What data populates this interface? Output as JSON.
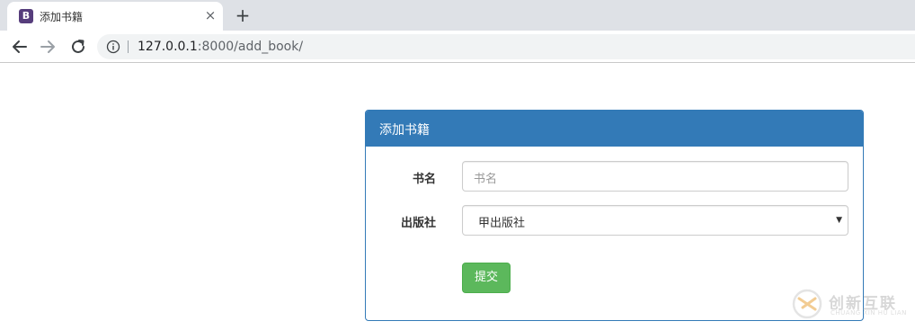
{
  "browser": {
    "tab": {
      "favicon_letter": "B",
      "title": "添加书籍",
      "close_glyph": "×"
    },
    "new_tab_glyph": "+",
    "url_host": "127.0.0.1",
    "url_rest": ":8000/add_book/",
    "icons": [
      "back-arrow-icon",
      "forward-arrow-icon",
      "reload-icon",
      "info-icon"
    ]
  },
  "panel": {
    "title": "添加书籍",
    "form": {
      "name_label": "书名",
      "name_placeholder": "书名",
      "publisher_label": "出版社",
      "publisher_selected": "甲出版社",
      "submit_label": "提交"
    }
  },
  "watermark": {
    "text": "创新互联",
    "sub": "CHUANG XIN HU LIAN"
  },
  "colors": {
    "panel_primary": "#337ab7",
    "submit_green": "#5cb85c",
    "bootstrap_purple": "#563d7c"
  }
}
